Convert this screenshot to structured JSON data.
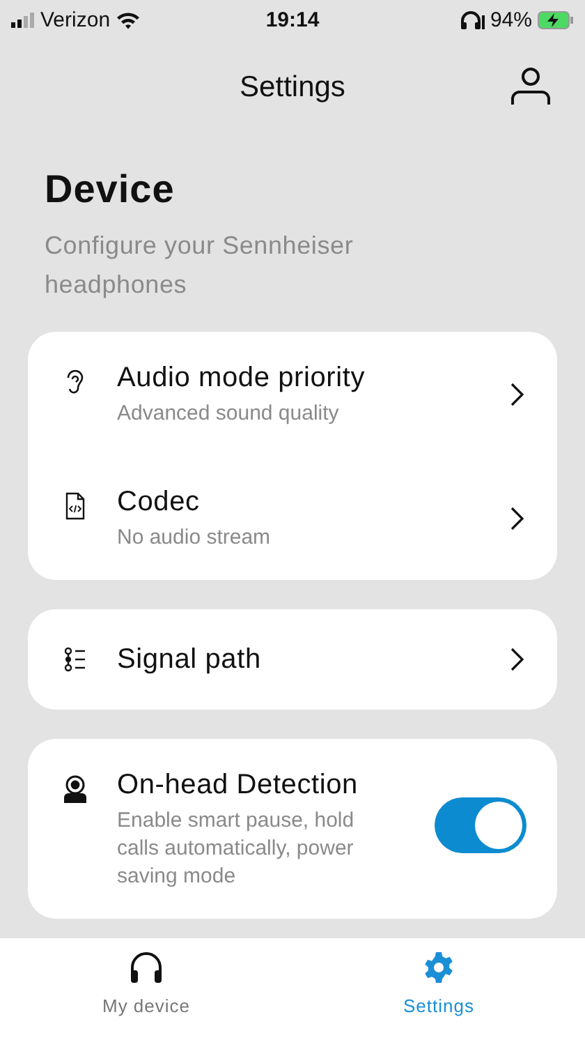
{
  "status_bar": {
    "carrier": "Verizon",
    "time": "19:14",
    "battery": "94%"
  },
  "header": {
    "title": "Settings"
  },
  "page": {
    "heading": "Device",
    "subtitle": "Configure your Sennheiser headphones"
  },
  "groups": [
    {
      "items": [
        {
          "kind": "nav",
          "title": "Audio mode priority",
          "subtitle": "Advanced sound quality"
        },
        {
          "kind": "nav",
          "title": "Codec",
          "subtitle": "No audio stream"
        }
      ]
    },
    {
      "items": [
        {
          "kind": "nav",
          "title": "Signal path"
        }
      ]
    },
    {
      "items": [
        {
          "kind": "toggle",
          "title": "On-head Detection",
          "subtitle": "Enable smart pause, hold calls automatically, power saving mode",
          "on": true
        }
      ]
    }
  ],
  "tabs": [
    {
      "label": "My device",
      "selected": false
    },
    {
      "label": "Settings",
      "selected": true
    }
  ]
}
